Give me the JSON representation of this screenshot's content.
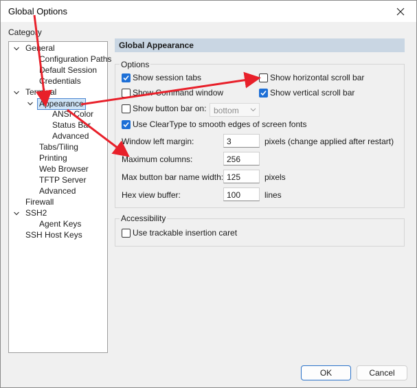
{
  "window": {
    "title": "Global Options"
  },
  "category": {
    "label": "Category",
    "tree": [
      {
        "label": "General"
      },
      {
        "label": "Configuration Paths"
      },
      {
        "label": "Default Session"
      },
      {
        "label": "Credentials"
      },
      {
        "label": "Terminal"
      },
      {
        "label": "Appearance"
      },
      {
        "label": "ANSI Color"
      },
      {
        "label": "Status Bar"
      },
      {
        "label": "Advanced"
      },
      {
        "label": "Tabs/Tiling"
      },
      {
        "label": "Printing"
      },
      {
        "label": "Web Browser"
      },
      {
        "label": "TFTP Server"
      },
      {
        "label": "Advanced"
      },
      {
        "label": "Firewall"
      },
      {
        "label": "SSH2"
      },
      {
        "label": "Agent Keys"
      },
      {
        "label": "SSH Host Keys"
      }
    ]
  },
  "panel": {
    "header": "Global Appearance",
    "options": {
      "legend": "Options",
      "show_session_tabs": {
        "label": "Show session tabs",
        "checked": true
      },
      "show_horizontal_scroll_bar": {
        "label": "Show horizontal scroll bar",
        "checked": false
      },
      "show_command_window": {
        "label": "Show Command window",
        "checked": false
      },
      "show_vertical_scroll_bar": {
        "label": "Show vertical scroll bar",
        "checked": true
      },
      "show_button_bar_on": {
        "label": "Show button bar on:",
        "checked": false,
        "value": "bottom"
      },
      "use_cleartype": {
        "label": "Use ClearType to smooth edges of screen fonts",
        "checked": true
      },
      "window_left_margin": {
        "label": "Window left margin:",
        "value": "3",
        "suffix": "pixels (change applied after restart)"
      },
      "maximum_columns": {
        "label": "Maximum columns:",
        "value": "256"
      },
      "max_button_bar_name_width": {
        "label": "Max button bar name width:",
        "value": "125",
        "suffix": "pixels"
      },
      "hex_view_buffer": {
        "label": "Hex view buffer:",
        "value": "100",
        "suffix": "lines"
      }
    },
    "accessibility": {
      "legend": "Accessibility",
      "use_trackable_caret": {
        "label": "Use trackable insertion caret",
        "checked": false
      }
    }
  },
  "buttons": {
    "ok": "OK",
    "cancel": "Cancel"
  },
  "colors": {
    "accent": "#1d6fd6",
    "annotation": "#e8202a",
    "header_bg": "#c9d6e3"
  }
}
